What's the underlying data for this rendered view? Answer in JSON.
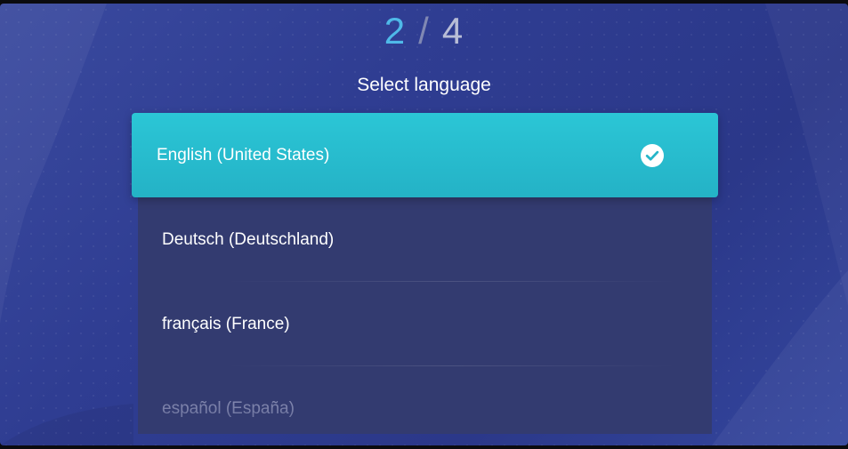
{
  "header": {
    "step_current": "2",
    "step_separator": "/",
    "step_total": "4",
    "title": "Select language"
  },
  "languages": {
    "selected": {
      "label": "English (United States)",
      "icon": "check-circle-icon"
    },
    "items": [
      {
        "label": "Deutsch (Deutschland)"
      },
      {
        "label": "français (France)"
      },
      {
        "label": "español (España)"
      }
    ]
  },
  "colors": {
    "accent": "#2bc6d6",
    "step_current": "#4fb9e8",
    "background": "#2f3d92",
    "list_background": "#333b70"
  }
}
